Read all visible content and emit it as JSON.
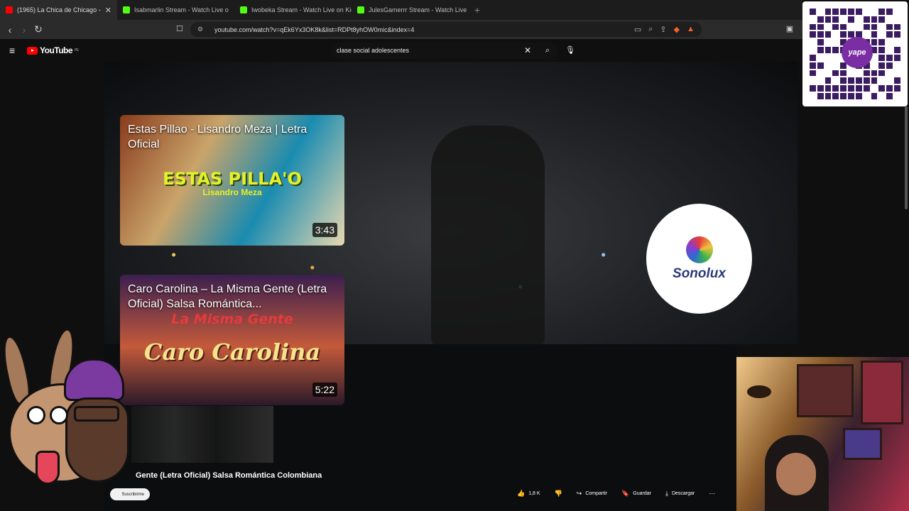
{
  "browser": {
    "tabs": [
      {
        "label": "(1965) La Chica de Chicago -",
        "color": "#ff0000",
        "active": true
      },
      {
        "label": "Isabmarlin Stream - Watch Live o",
        "color": "#53fc18"
      },
      {
        "label": "Iwobeka Stream - Watch Live on Kick",
        "color": "#53fc18"
      },
      {
        "label": "JulesGamerrr Stream - Watch Live o",
        "color": "#53fc18"
      }
    ],
    "url": "youtube.com/watch?v=qEk6Yx3OK8k&list=RDPt8yhOW0mic&index=4"
  },
  "youtube": {
    "logo_text": "YouTube",
    "logo_region": "PE",
    "search_value": "clase social adolescentes"
  },
  "endscreen": {
    "cards": [
      {
        "title": "Estas Pillao - Lisandro Meza | Letra Oficial",
        "art_title": "ESTAS PILLA'O",
        "art_sub": "Lisandro Meza",
        "duration": "3:43"
      },
      {
        "title": "Caro Carolina – La Misma Gente (Letra Oficial) Salsa Romántica...",
        "art_title": "La Misma Gente",
        "art_sub": "Caro Carolina",
        "duration": "5:22"
      }
    ],
    "brand": "Sonolux"
  },
  "video": {
    "title": "Gente (Letra Oficial) Salsa Romántica Colombiana",
    "subscribe_label": "Suscribirme",
    "actions": {
      "likes": "1,8 K",
      "share": "Compartir",
      "save": "Guardar",
      "download": "Descargar"
    }
  },
  "overlay": {
    "qr_label": "yape"
  }
}
